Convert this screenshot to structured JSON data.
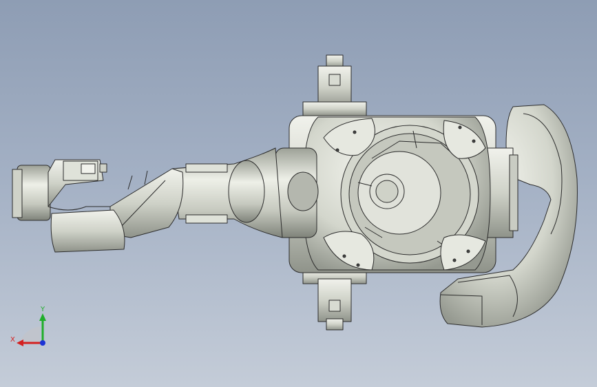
{
  "triad": {
    "x_label": "X",
    "y_label": "Y",
    "x_color": "#d42020",
    "y_color": "#1fae2a",
    "z_color": "#1b33d6"
  },
  "model": {
    "kind": "robot-arm-wireframe",
    "edge_color": "#2a2a2a",
    "shade_light": "#eceee6",
    "shade_mid": "#c8cbc2",
    "shade_dark": "#8d9088"
  }
}
